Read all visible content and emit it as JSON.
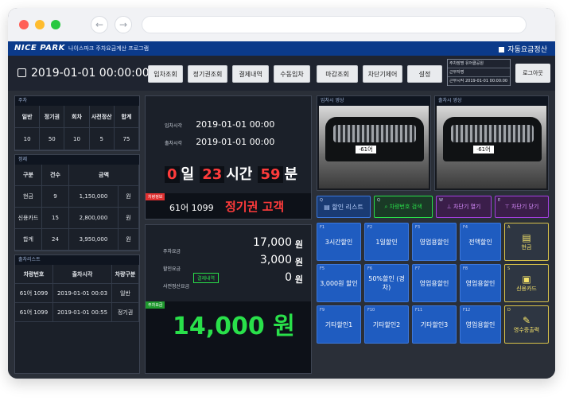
{
  "browser": {
    "back": "←",
    "forward": "→"
  },
  "header": {
    "logo": "NICE PARK",
    "subtitle": "나이스파크 주차요금계산 프로그램",
    "auto_pay": "자동요금정산"
  },
  "toolbar": {
    "datetime": "2019-01-01 00:00:00",
    "buttons": [
      "입차조회",
      "정기권조회",
      "결제내역",
      "수동입차",
      "마감조회",
      "차단기제어",
      "설정"
    ],
    "info": [
      "주차장명  유어클공원",
      "근무자명",
      "근무시작  2019-01-01 00:00:00"
    ],
    "logout": "로그아웃"
  },
  "parking": {
    "title": "주차",
    "headers": [
      "일반",
      "정기권",
      "회차",
      "사전정산",
      "합계"
    ],
    "values": [
      "10",
      "50",
      "10",
      "5",
      "75"
    ]
  },
  "settlement": {
    "title": "정제",
    "headers": [
      "구분",
      "건수",
      "금액"
    ],
    "rows": [
      [
        "현금",
        "9",
        "1,150,000",
        "원"
      ],
      [
        "신용카드",
        "15",
        "2,800,000",
        "원"
      ],
      [
        "합계",
        "24",
        "3,950,000",
        "원"
      ]
    ]
  },
  "list": {
    "title": "출차리스트",
    "headers": [
      "차량번호",
      "출차시각",
      "차량구분"
    ],
    "rows": [
      [
        "61어 1099",
        "2019-01-01 00:03",
        "일반"
      ],
      [
        "61어 1099",
        "2019-01-01 00:55",
        "정기권"
      ]
    ]
  },
  "times": {
    "in_label": "입차시각",
    "in_value": "2019-01-01 00:00",
    "out_label": "출차시각",
    "out_value": "2019-01-01 00:00",
    "d": "0",
    "d_unit": "일",
    "h": "23",
    "h_unit": "시간",
    "m": "59",
    "m_unit": "분"
  },
  "vehicle": {
    "badge": "차량정보",
    "plate": "61어 1099",
    "type": "정기권 고객"
  },
  "fees": {
    "parking_label": "주차요금",
    "parking": "17,000",
    "unit": "원",
    "discount_label": "할인요금",
    "discount": "3,000",
    "prepay_label": "사전정산요금",
    "prepay_btn": "결제내역",
    "prepay": "0",
    "total_badge": "주차요금",
    "total": "14,000 원"
  },
  "cams": {
    "in_title": "입차시 영상",
    "out_title": "출차시 영상",
    "plate": "·61어"
  },
  "actions": [
    {
      "key": "Q",
      "label": "할인 리스트"
    },
    {
      "key": "Q",
      "label": "차량번호 검색"
    },
    {
      "key": "W",
      "label": "차단기 열기"
    },
    {
      "key": "E",
      "label": "차단기 닫기"
    }
  ],
  "discounts": [
    {
      "key": "F1",
      "label": "3시간할인"
    },
    {
      "key": "F2",
      "label": "1일할인"
    },
    {
      "key": "F3",
      "label": "영업용할인"
    },
    {
      "key": "F4",
      "label": "전액할인"
    },
    {
      "key": "F5",
      "label": "3,000원 할인"
    },
    {
      "key": "F6",
      "label": "50%할인 (경차)"
    },
    {
      "key": "F7",
      "label": "영업용할인"
    },
    {
      "key": "F8",
      "label": "영업용할인"
    },
    {
      "key": "F9",
      "label": "기타할인1"
    },
    {
      "key": "F10",
      "label": "기타할인2"
    },
    {
      "key": "F11",
      "label": "기타할인3"
    },
    {
      "key": "F12",
      "label": "영업용할인"
    }
  ],
  "payments": [
    {
      "key": "A",
      "label": "현금"
    },
    {
      "key": "S",
      "label": "신용카드"
    },
    {
      "key": "D",
      "label": "영수증출력"
    }
  ],
  "colors": {
    "accent": "#1f5cc0",
    "brand_bar": "#0b3a8a",
    "red": "#ff3b3b",
    "green": "#29e04a",
    "purple": "#a43fe0"
  }
}
